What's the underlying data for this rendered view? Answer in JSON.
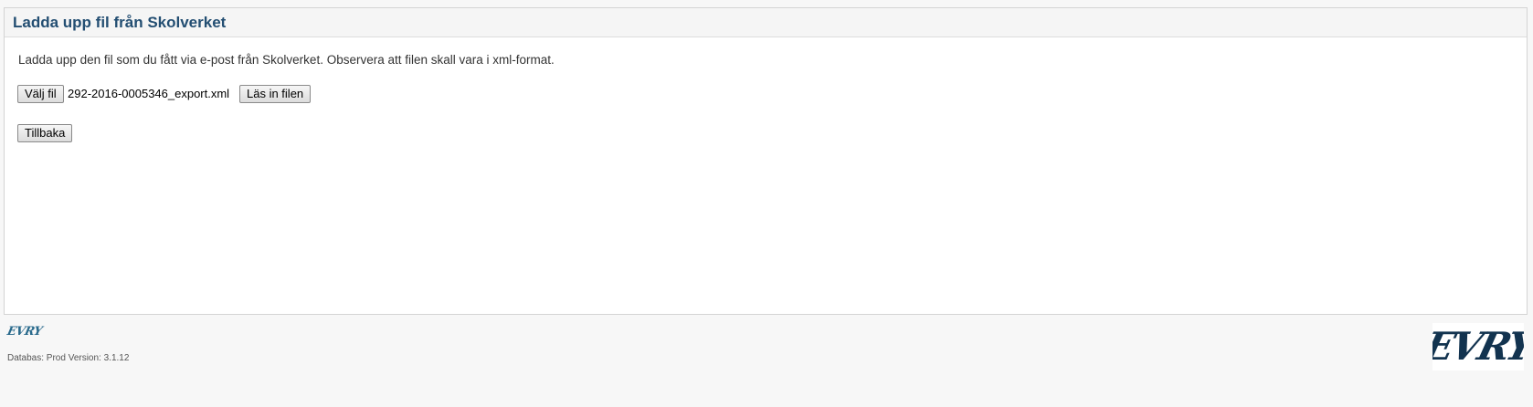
{
  "header": {
    "title": "Ladda upp fil från Skolverket"
  },
  "main": {
    "description": "Ladda upp den fil som du fått via e-post från Skolverket. Observera att filen skall vara i xml-format.",
    "choose_file_label": "Välj fil",
    "selected_file_name": "292-2016-0005346_export.xml",
    "load_file_label": "Läs in filen",
    "back_label": "Tillbaka"
  },
  "footer": {
    "small_logo_text": "EVRY",
    "version_text": "Databas: Prod Version: 3.1.12",
    "large_logo_text": "EVRY"
  },
  "colors": {
    "title": "#234e72",
    "page_background": "#f7f7f7",
    "panel_background": "#ffffff",
    "logo": "#12334f"
  }
}
